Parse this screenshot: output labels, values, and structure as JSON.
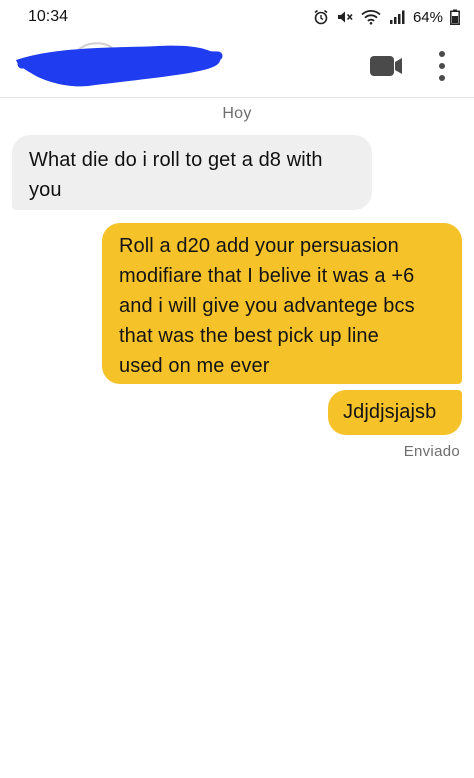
{
  "status_bar": {
    "time": "10:34",
    "battery_percent": "64%",
    "icons": [
      "alarm-icon",
      "mute-icon",
      "wifi-icon",
      "signal-icon",
      "battery-icon"
    ]
  },
  "header": {
    "contact_name": "",
    "contact_name_redacted": true,
    "actions": [
      "video-call-icon",
      "more-options-icon"
    ]
  },
  "conversation": {
    "date_label": "Hoy",
    "messages": [
      {
        "direction": "incoming",
        "lines": [
          "What die do i roll to get a d8 with",
          "you"
        ]
      },
      {
        "direction": "outgoing",
        "lines": [
          "Roll a d20 add your persuasion",
          "modifiare that I belive it was a +6",
          "and i will give you advantege bcs",
          "that was the best pick up line",
          "used on me ever"
        ]
      },
      {
        "direction": "outgoing",
        "lines": [
          "Jdjdjsjajsb"
        ]
      }
    ],
    "sent_status": "Enviado"
  },
  "colors": {
    "incoming_bubble": "#efefef",
    "outgoing_bubble": "#f6c22a",
    "redaction": "#1f3cf0",
    "muted_text": "#6e6e6e"
  }
}
